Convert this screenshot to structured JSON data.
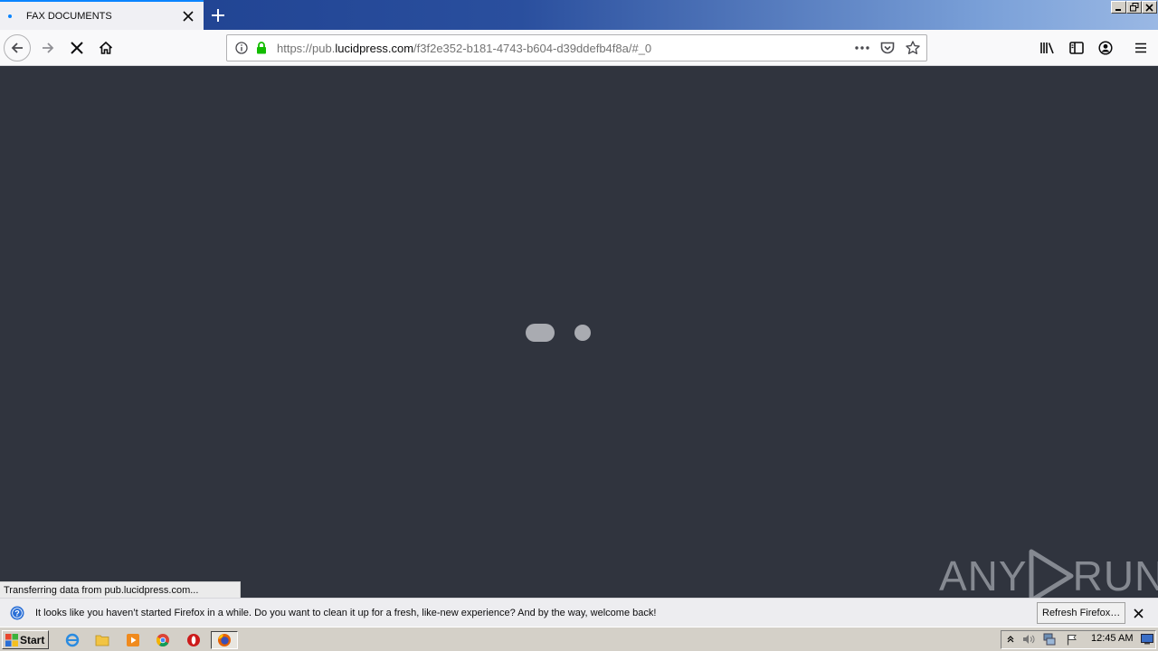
{
  "browser": {
    "tab_title": "FAX DOCUMENTS",
    "url_prefix": "https://pub.",
    "url_host": "lucidpress.com",
    "url_path": "/f3f2e352-b181-4743-b604-d39ddefb4f8a/#_0"
  },
  "status_bar": {
    "text": "Transferring data from pub.lucidpress.com..."
  },
  "watermark": {
    "left": "ANY",
    "right": "RUN"
  },
  "notification": {
    "message": "It looks like you haven’t started Firefox in a while. Do you want to clean it up for a fresh, like-new experience? And by the way, welcome back!",
    "button_label": "Refresh Firefox…"
  },
  "taskbar": {
    "start_label": "Start",
    "clock": "12:45 AM",
    "icons": [
      "internet-explorer-icon",
      "file-explorer-icon",
      "media-player-icon",
      "chrome-icon",
      "opera-icon",
      "firefox-icon"
    ]
  },
  "colors": {
    "content_bg": "#30343e",
    "accent": "#0a84ff",
    "secure_lock": "#12bc00"
  }
}
